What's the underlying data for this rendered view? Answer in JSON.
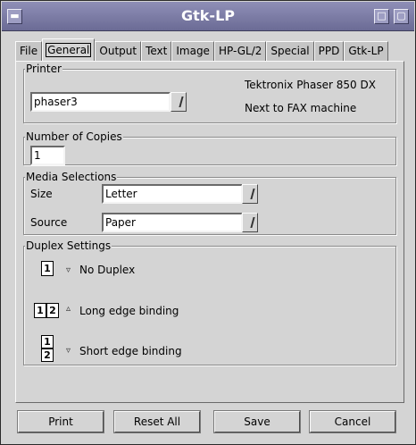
{
  "window": {
    "title": "Gtk-LP"
  },
  "tabs": [
    "File",
    "General",
    "Output",
    "Text",
    "Image",
    "HP-GL/2",
    "Special",
    "PPD",
    "Gtk-LP"
  ],
  "printer": {
    "section_label": "Printer",
    "selected": "phaser3",
    "model": "Tektronix Phaser 850 DX",
    "location": "Next to FAX machine"
  },
  "copies": {
    "section_label": "Number of Copies",
    "value": "1"
  },
  "media": {
    "section_label": "Media Selections",
    "size_label": "Size",
    "size_value": "Letter",
    "source_label": "Source",
    "source_value": "Paper"
  },
  "duplex": {
    "section_label": "Duplex Settings",
    "options": [
      {
        "label": "No Duplex",
        "selected": false
      },
      {
        "label": "Long edge binding",
        "selected": true
      },
      {
        "label": "Short edge binding",
        "selected": false
      }
    ],
    "icon_single": "1",
    "icon_first": "1",
    "icon_second": "2"
  },
  "buttons": {
    "print": "Print",
    "reset_all": "Reset All",
    "save": "Save",
    "cancel": "Cancel"
  }
}
